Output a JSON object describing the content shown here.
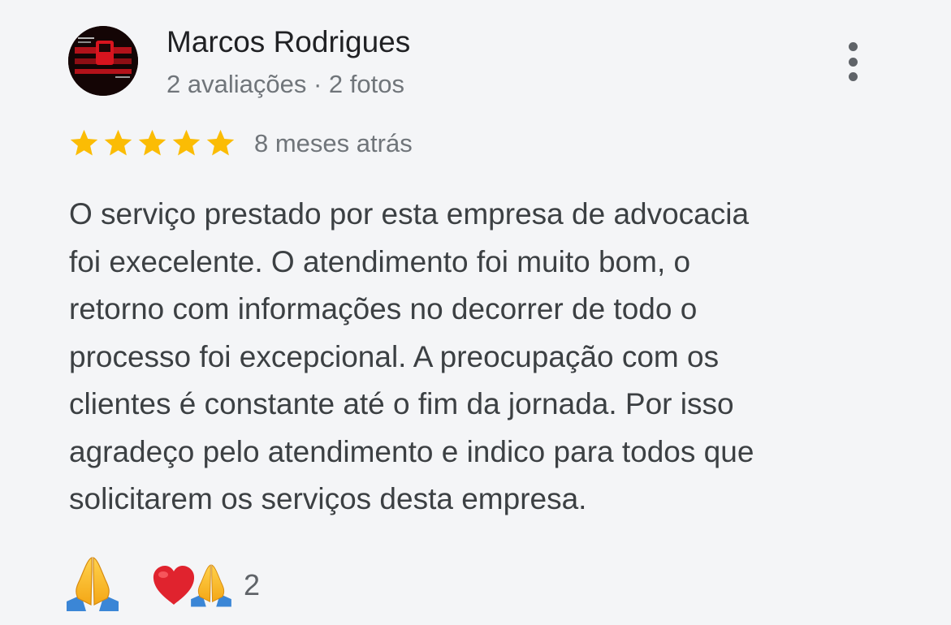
{
  "review": {
    "author": {
      "name": "Marcos Rodrigues",
      "meta": "2 avaliações · 2 fotos"
    },
    "rating": 5,
    "rating_max": 5,
    "time_ago": "8 meses atrás",
    "text_lines": [
      "O serviço prestado por esta empresa de advocacia",
      "foi execelente. O atendimento foi muito bom, o",
      "retorno com informações no decorrer de todo o",
      "processo foi excepcional. A preocupação com os",
      "clientes é constante até o fim da jornada. Por isso",
      "agradeço pelo atendimento e indico para todos que",
      "solicitarem os serviços desta empresa."
    ],
    "reactions": {
      "own_reaction_icon": "folded-hands-icon",
      "summary_icons": [
        "heart-icon",
        "folded-hands-icon"
      ],
      "count": "2"
    },
    "more_options_icon": "more-vert-icon"
  },
  "colors": {
    "background": "#f4f5f7",
    "star": "#fbbc04",
    "name": "#202124",
    "body_text": "#3c4043",
    "secondary_text": "#70757a",
    "heart": "#e0232e"
  }
}
